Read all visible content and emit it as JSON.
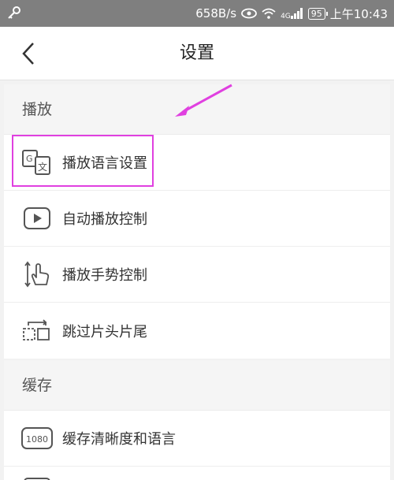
{
  "status_bar": {
    "network_speed": "658B/s",
    "signal_label": "4G",
    "battery": "95",
    "time": "上午10:43"
  },
  "nav": {
    "title": "设置"
  },
  "sections": [
    {
      "header": "播放",
      "items": [
        {
          "label": "播放语言设置",
          "icon": "language-translate-icon"
        },
        {
          "label": "自动播放控制",
          "icon": "play-icon"
        },
        {
          "label": "播放手势控制",
          "icon": "gesture-icon"
        },
        {
          "label": "跳过片头片尾",
          "icon": "skip-intro-icon"
        }
      ]
    },
    {
      "header": "缓存",
      "items": [
        {
          "label": "缓存清晰度和语言",
          "icon": "1080-quality-icon",
          "icon_text": "1080"
        }
      ]
    }
  ],
  "colors": {
    "status_bar_bg": "#7f7f7f",
    "highlight": "#e040e0"
  }
}
